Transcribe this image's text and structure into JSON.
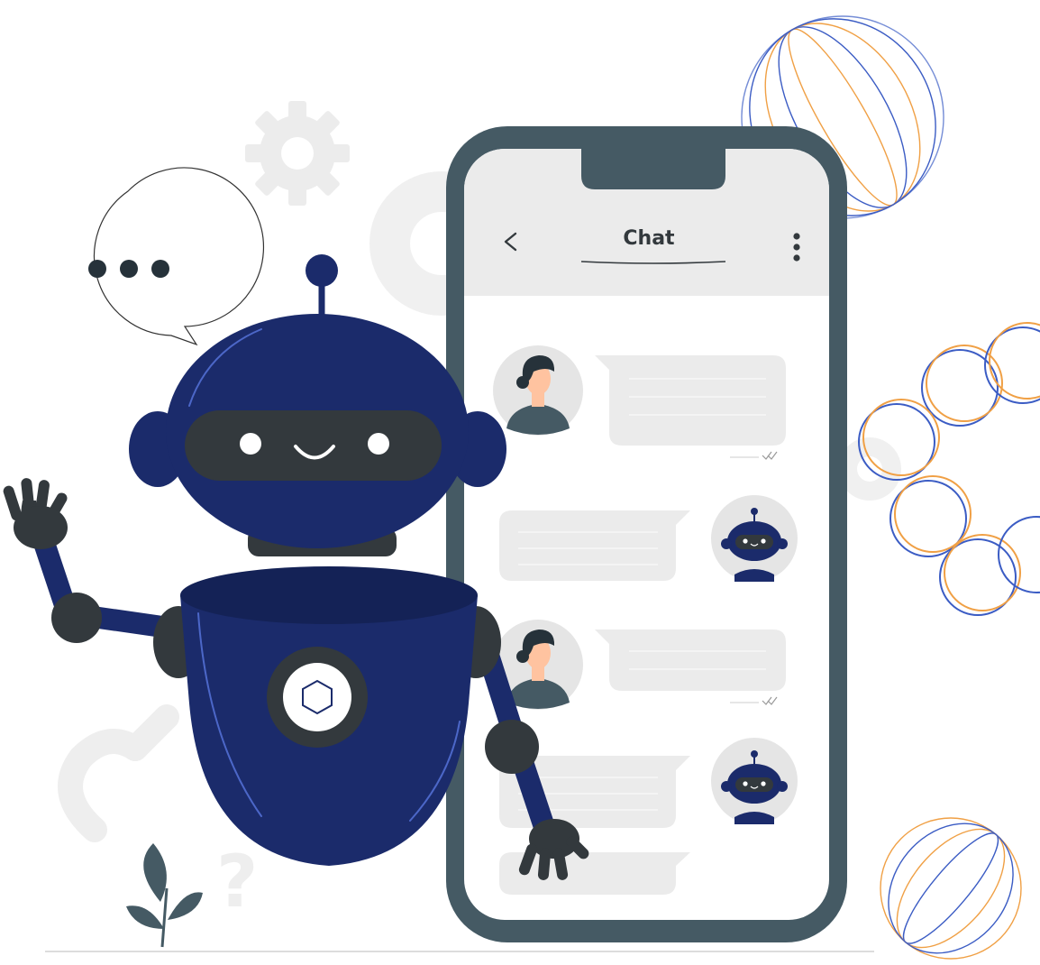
{
  "phone": {
    "header_title": "Chat"
  },
  "icons": {
    "back": "chevron-left-icon",
    "menu": "more-vertical-icon",
    "typing": "typing-bubble-icon",
    "gear": "gear-icon",
    "read_receipt": "double-check-icon"
  },
  "colors": {
    "robot_navy": "#1b2b6b",
    "robot_dark": "#33393d",
    "phone_frame": "#455a64",
    "bubble_gray": "#ebebeb",
    "orange_accent": "#f0a045",
    "blue_accent": "#3b5cc4"
  }
}
